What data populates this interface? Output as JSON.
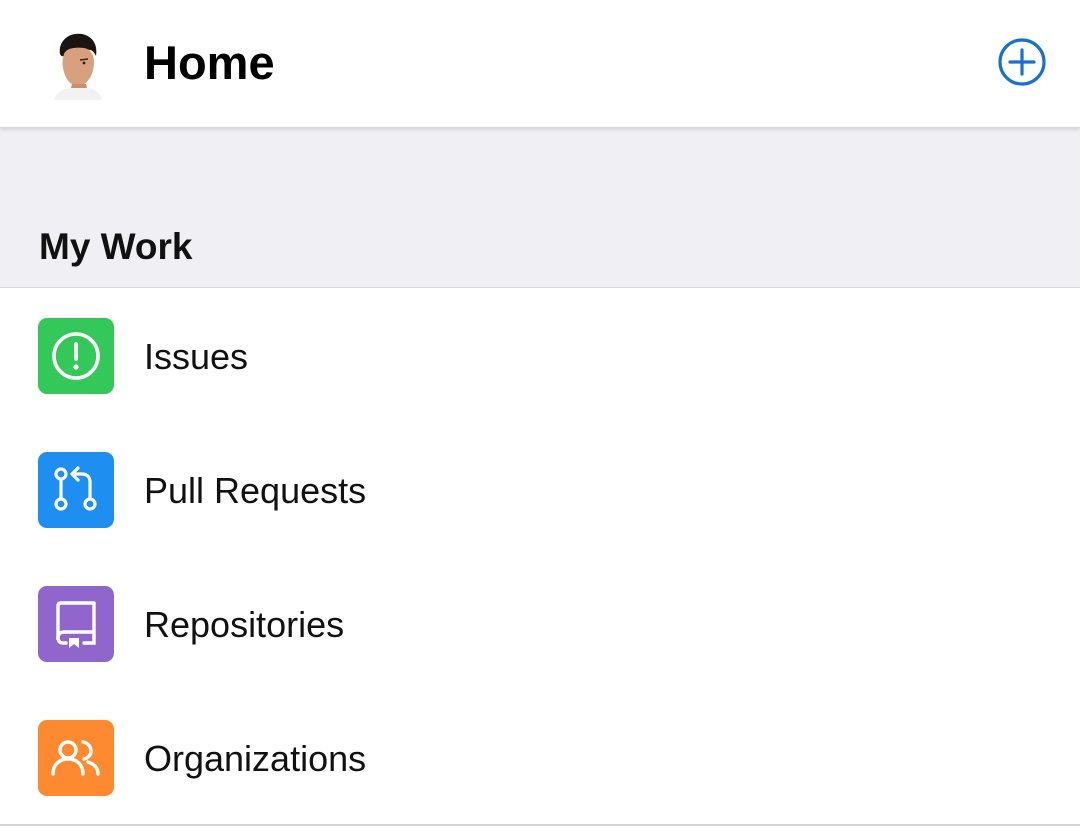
{
  "header": {
    "title": "Home",
    "avatar_icon": "user-avatar",
    "add_icon": "plus-circle-icon",
    "accent_color": "#1a73e8"
  },
  "section": {
    "title": "My Work"
  },
  "items": [
    {
      "label": "Issues",
      "icon": "issue-icon",
      "color": "#34c759"
    },
    {
      "label": "Pull Requests",
      "icon": "pull-request-icon",
      "color": "#1f8ef1"
    },
    {
      "label": "Repositories",
      "icon": "repository-icon",
      "color": "#9166cc"
    },
    {
      "label": "Organizations",
      "icon": "organization-icon",
      "color": "#fd8a31"
    }
  ]
}
